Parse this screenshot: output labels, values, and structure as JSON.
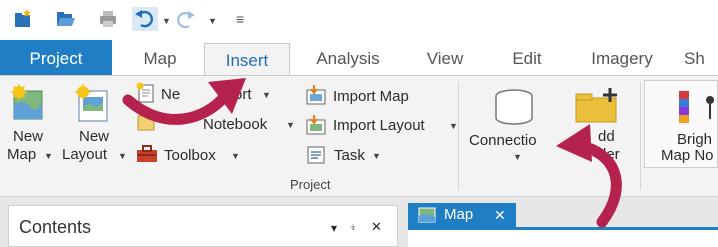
{
  "quick_access": {
    "icons": [
      "new-project-icon",
      "open-project-icon",
      "print-icon",
      "undo-icon",
      "redo-icon",
      "customize-icon"
    ],
    "customize_glyph": "≡"
  },
  "tabs": [
    {
      "label": "Project"
    },
    {
      "label": "Map"
    },
    {
      "label": "Insert"
    },
    {
      "label": "Analysis"
    },
    {
      "label": "View"
    },
    {
      "label": "Edit"
    },
    {
      "label": "Imagery"
    },
    {
      "label": "Sh"
    }
  ],
  "ribbon": {
    "new_map": {
      "line1": "New",
      "line2": "Map"
    },
    "new_layout": {
      "line1": "New",
      "line2": "Layout"
    },
    "new_report": "Ne",
    "report_tail": "ort",
    "notebook_tail": "Notebook",
    "toolbox": "Toolbox",
    "import_map": "Import Map",
    "import_layout": "Import Layout",
    "task": "Task",
    "group_label": "Project",
    "connections": "Connectio",
    "add_folder": {
      "line1": "dd",
      "line2": "der"
    },
    "basemap": {
      "line1": "Brigh",
      "line2": "Map No"
    }
  },
  "panes": {
    "contents_title": "Contents",
    "contents_controls": {
      "dropdown": "▾",
      "pin": "⍖",
      "close": "✕"
    },
    "map_tab_label": "Map",
    "map_tab_close": "✕"
  },
  "colors": {
    "accent": "#1f7ec4",
    "arrow": "#b5224e",
    "ribbon_bg": "#f3f3f3"
  }
}
